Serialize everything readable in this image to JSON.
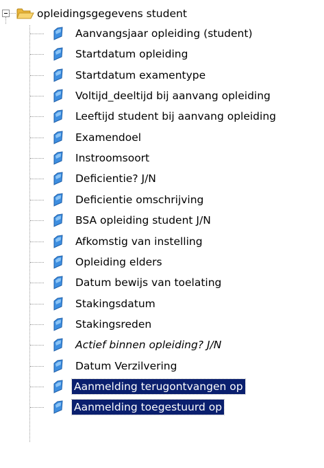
{
  "tree": {
    "root": {
      "label": "opleidingsgegevens student",
      "expander_icon": "minus-box-icon",
      "folder_icon": "open-folder-icon"
    },
    "item_icon": "blue-flag-icon",
    "items": [
      {
        "label": "Aanvangsjaar opleiding (student)",
        "italic": false,
        "selected": false
      },
      {
        "label": "Startdatum opleiding",
        "italic": false,
        "selected": false
      },
      {
        "label": "Startdatum examentype",
        "italic": false,
        "selected": false
      },
      {
        "label": "Voltijd_deeltijd bij aanvang opleiding",
        "italic": false,
        "selected": false
      },
      {
        "label": "Leeftijd student bij aanvang opleiding",
        "italic": false,
        "selected": false
      },
      {
        "label": "Examendoel",
        "italic": false,
        "selected": false
      },
      {
        "label": "Instroomsoort",
        "italic": false,
        "selected": false
      },
      {
        "label": "Deficientie? J/N",
        "italic": false,
        "selected": false
      },
      {
        "label": "Deficientie omschrijving",
        "italic": false,
        "selected": false
      },
      {
        "label": "BSA opleiding student J/N",
        "italic": false,
        "selected": false
      },
      {
        "label": "Afkomstig van instelling",
        "italic": false,
        "selected": false
      },
      {
        "label": "Opleiding elders",
        "italic": false,
        "selected": false
      },
      {
        "label": "Datum bewijs van toelating",
        "italic": false,
        "selected": false
      },
      {
        "label": "Stakingsdatum",
        "italic": false,
        "selected": false
      },
      {
        "label": "Stakingsreden",
        "italic": false,
        "selected": false
      },
      {
        "label": "Actief binnen opleiding? J/N",
        "italic": true,
        "selected": false
      },
      {
        "label": "Datum Verzilvering",
        "italic": false,
        "selected": false
      },
      {
        "label": "Aanmelding terugontvangen op",
        "italic": false,
        "selected": true
      },
      {
        "label": "Aanmelding toegestuurd op",
        "italic": false,
        "selected": true
      }
    ],
    "colors": {
      "selection_background": "#0a1f6e",
      "selection_text": "#ffffff",
      "icon_blue": "#3d8ee0",
      "folder_yellow": "#f3c44a"
    }
  }
}
